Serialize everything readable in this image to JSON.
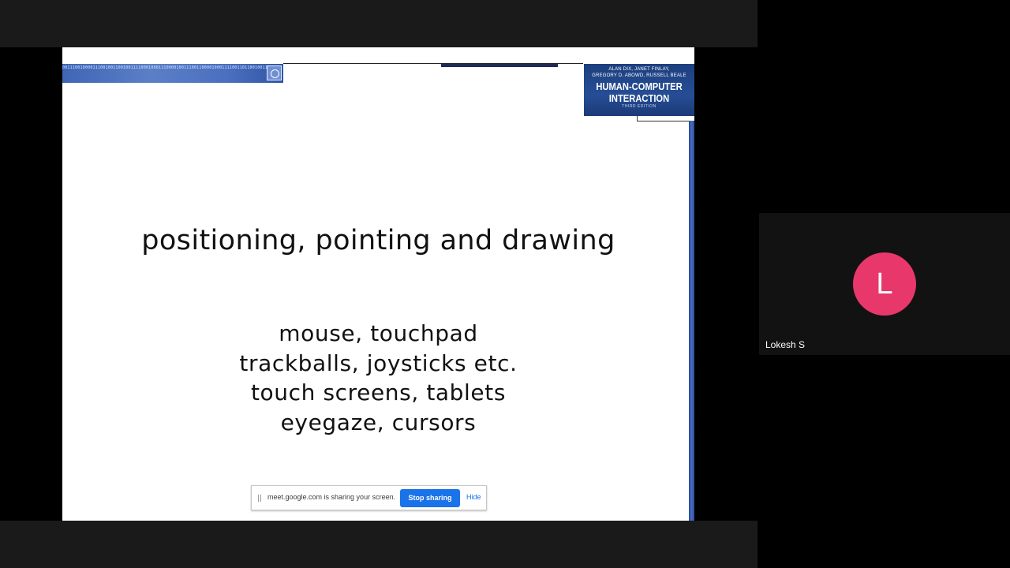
{
  "slide": {
    "binary_text": "0011100100001110010011001001111000100011100001001110011000010001111001101100100111001001100001110010011100100001110010011001001111000100011100001001110011000010001111001101100100111001001100001110010011100100",
    "book": {
      "authors_line1": "ALAN DIX, JANET FINLAY,",
      "authors_line2": "GREGORY D. ABOWD, RUSSELL BEALE",
      "title_line1": "HUMAN-COMPUTER",
      "title_line2": "INTERACTION",
      "edition": "THIRD EDITION"
    },
    "title": "positioning, pointing and drawing",
    "bullets": [
      "mouse, touchpad",
      "trackballs, joysticks etc.",
      "touch screens, tablets",
      "eyegaze, cursors"
    ]
  },
  "share_bar": {
    "message": "meet.google.com is sharing your screen.",
    "stop_label": "Stop sharing",
    "hide_label": "Hide"
  },
  "participant": {
    "initial": "L",
    "name": "Lokesh S",
    "avatar_color": "#e8386b"
  },
  "colors": {
    "accent": "#1a73e8",
    "background": "#000000"
  }
}
